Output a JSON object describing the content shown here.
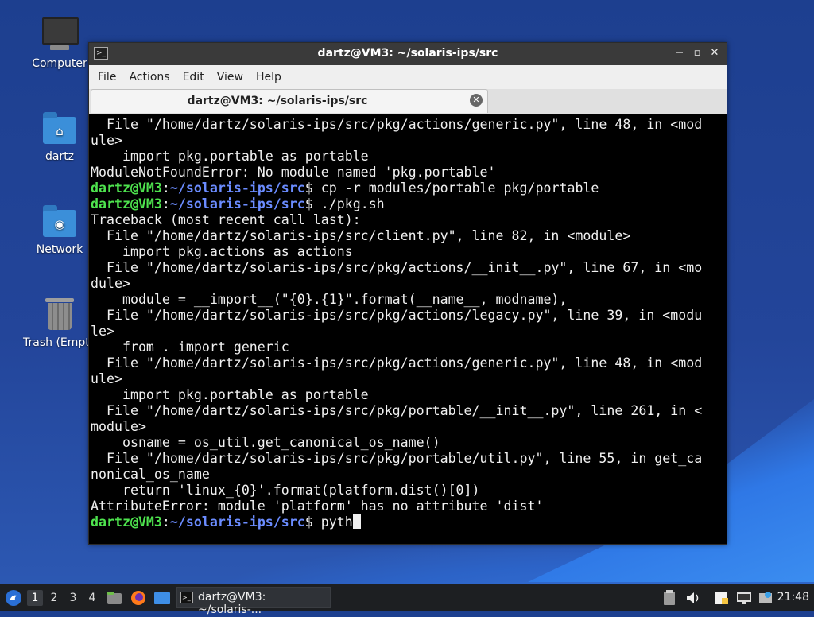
{
  "desktop": {
    "icons": [
      {
        "label": "Computer"
      },
      {
        "label": "dartz"
      },
      {
        "label": "Network"
      },
      {
        "label": "Trash (Empty)"
      }
    ]
  },
  "window": {
    "title": "dartz@VM3: ~/solaris-ips/src",
    "menu": [
      "File",
      "Actions",
      "Edit",
      "View",
      "Help"
    ],
    "tab_label": "dartz@VM3: ~/solaris-ips/src",
    "controls": {
      "minimize": "−",
      "maximize": "▫",
      "close": "✕"
    }
  },
  "terminal": {
    "prompt_user": "dartz@VM3",
    "prompt_path": "~/solaris-ips/src",
    "lines": [
      "  File \"/home/dartz/solaris-ips/src/pkg/actions/generic.py\", line 48, in <mod",
      "ule>",
      "    import pkg.portable as portable",
      "ModuleNotFoundError: No module named 'pkg.portable'",
      {
        "cmd": "cp -r modules/portable pkg/portable"
      },
      {
        "cmd": "./pkg.sh"
      },
      "Traceback (most recent call last):",
      "  File \"/home/dartz/solaris-ips/src/client.py\", line 82, in <module>",
      "    import pkg.actions as actions",
      "  File \"/home/dartz/solaris-ips/src/pkg/actions/__init__.py\", line 67, in <mo",
      "dule>",
      "    module = __import__(\"{0}.{1}\".format(__name__, modname),",
      "  File \"/home/dartz/solaris-ips/src/pkg/actions/legacy.py\", line 39, in <modu",
      "le>",
      "    from . import generic",
      "  File \"/home/dartz/solaris-ips/src/pkg/actions/generic.py\", line 48, in <mod",
      "ule>",
      "    import pkg.portable as portable",
      "  File \"/home/dartz/solaris-ips/src/pkg/portable/__init__.py\", line 261, in <",
      "module>",
      "    osname = os_util.get_canonical_os_name()",
      "  File \"/home/dartz/solaris-ips/src/pkg/portable/util.py\", line 55, in get_ca",
      "nonical_os_name",
      "    return 'linux_{0}'.format(platform.dist()[0])",
      "AttributeError: module 'platform' has no attribute 'dist'",
      {
        "cmd": "pyth",
        "cursor": true
      }
    ]
  },
  "taskbar": {
    "workspaces": [
      "1",
      "2",
      "3",
      "4"
    ],
    "active_workspace": "1",
    "task_label": "dartz@VM3: ~/solaris-...",
    "clock": "21:48"
  }
}
